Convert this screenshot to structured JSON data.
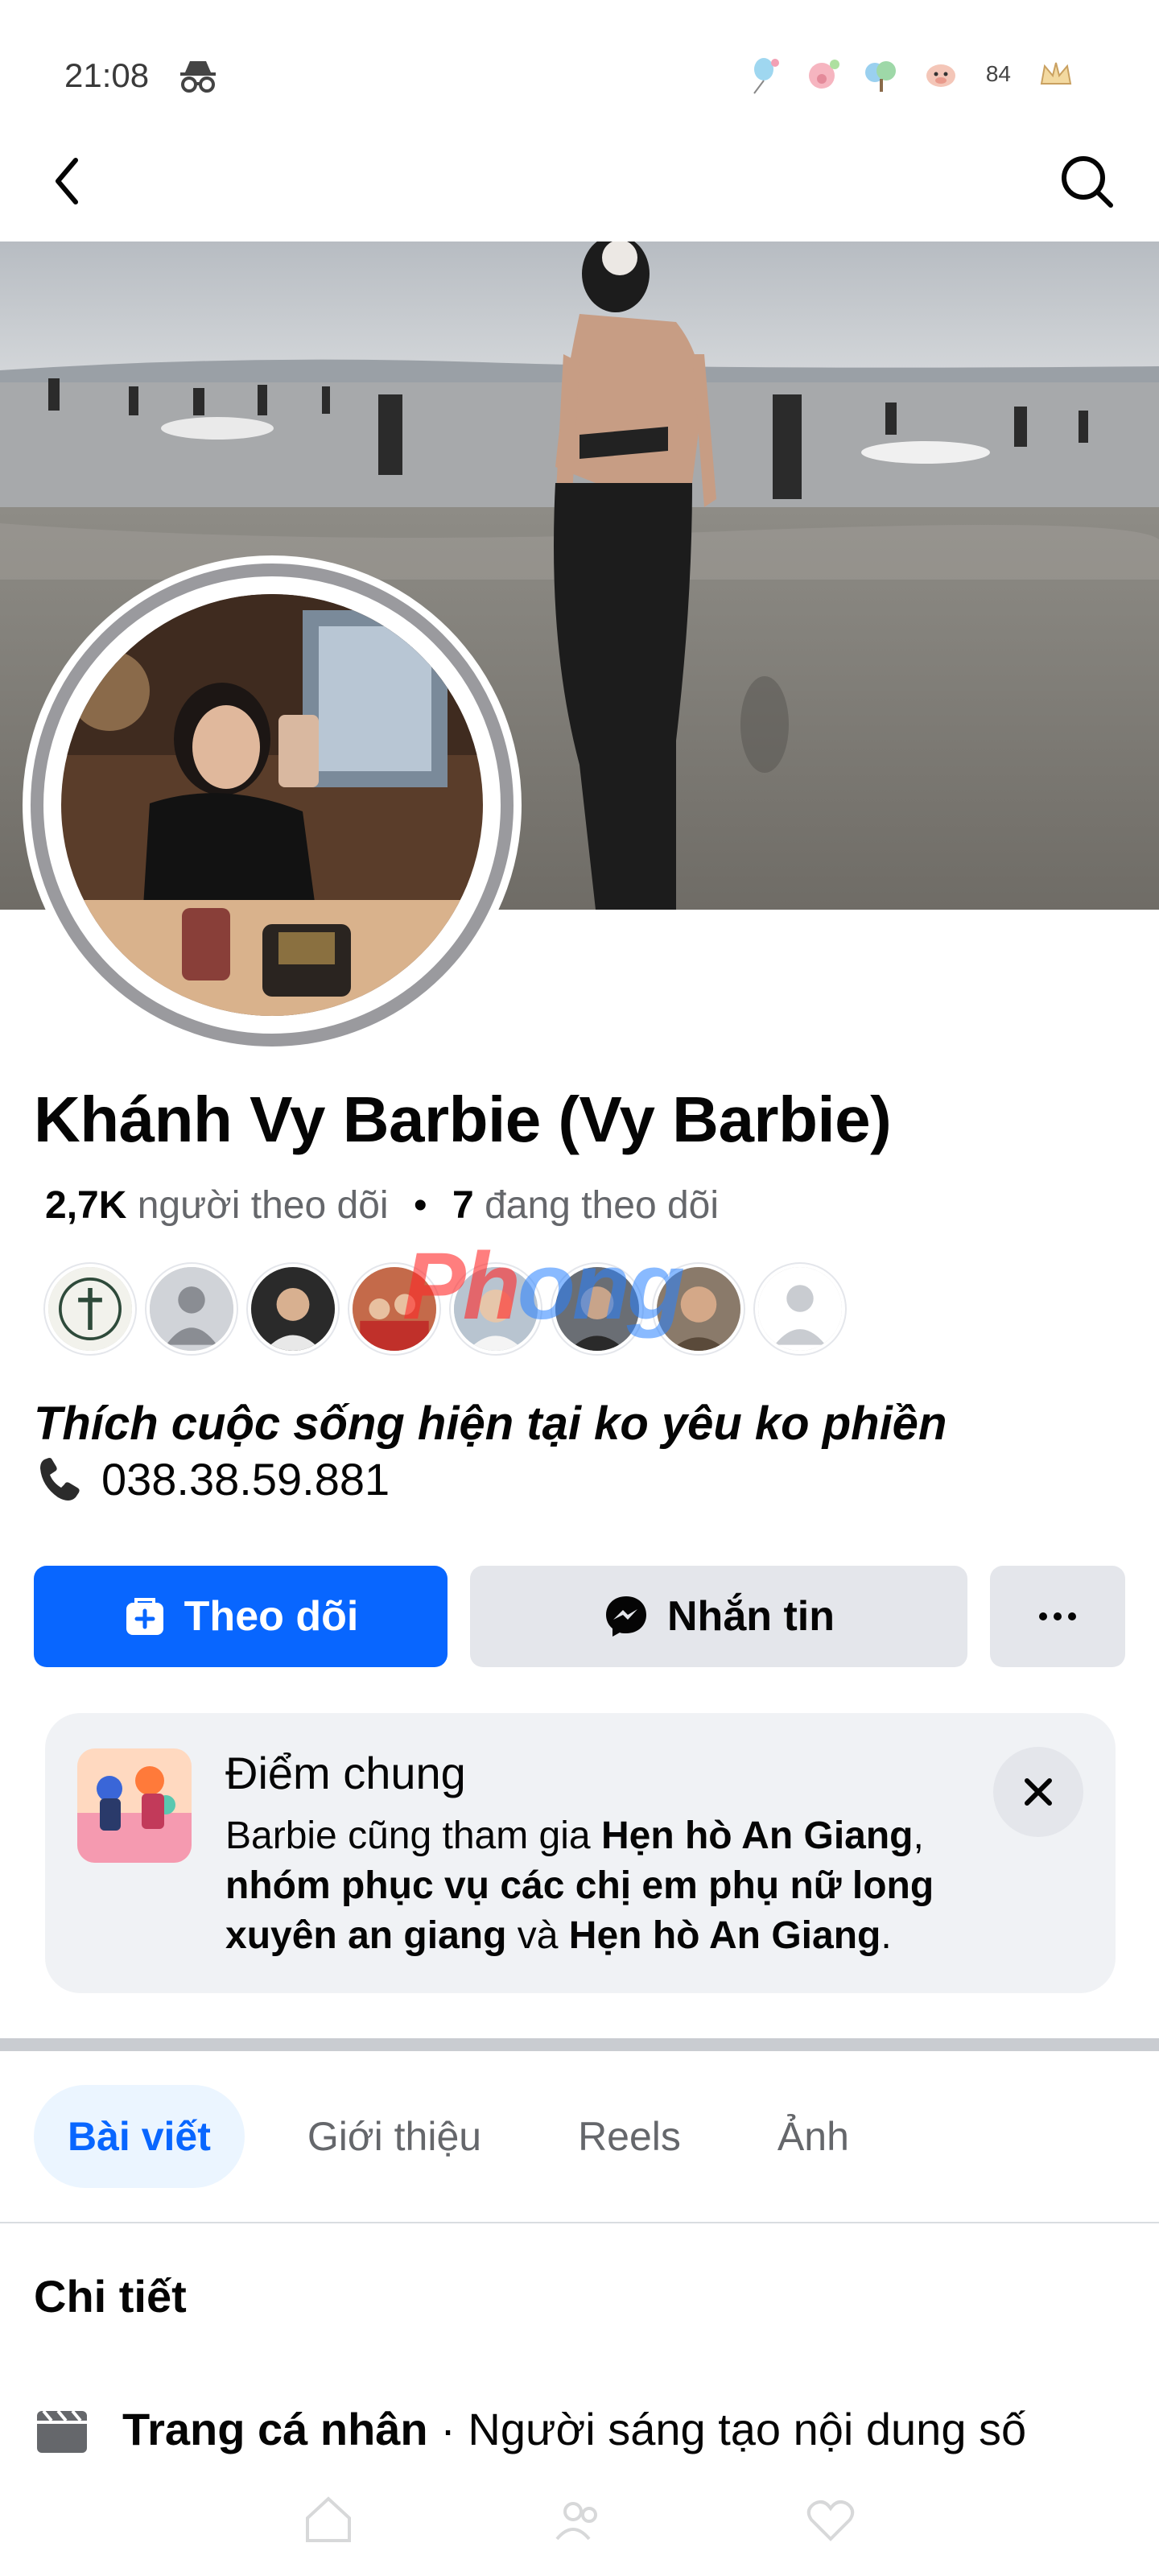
{
  "status_bar": {
    "time": "21:08",
    "notification_count": "84",
    "icons": [
      "incognito-icon",
      "notification-app-icons"
    ]
  },
  "app_bar": {
    "back_icon": "chevron-left-icon",
    "search_icon": "search-icon"
  },
  "profile": {
    "name": "Khánh Vy Barbie (Vy Barbie)",
    "followers_count": "2,7K",
    "followers_label": "người theo dõi",
    "following_count": "7",
    "following_label": "đang theo dõi",
    "bio": "Thích cuộc sống hiện tại ko yêu ko phiền",
    "phone": "038.38.59.881"
  },
  "watermark": {
    "part1": "Ph",
    "part2": "ong"
  },
  "actions": {
    "follow_label": "Theo dõi",
    "message_label": "Nhắn tin",
    "more_label": "···"
  },
  "common_card": {
    "title": "Điểm chung",
    "prefix": "Barbie cũng tham gia",
    "group1": "Hẹn hò An Giang",
    "group2": "nhóm phục vụ các chị em phụ nữ long xuyên an giang",
    "conj": "và",
    "group3": "Hẹn hò An Giang"
  },
  "tabs": [
    {
      "label": "Bài viết",
      "active": true
    },
    {
      "label": "Giới thiệu",
      "active": false
    },
    {
      "label": "Reels",
      "active": false
    },
    {
      "label": "Ảnh",
      "active": false
    }
  ],
  "details": {
    "title": "Chi tiết",
    "row_bold": "Trang cá nhân",
    "row_text": " · Người sáng tạo nội dung số"
  },
  "colors": {
    "accent": "#0866ff",
    "secondary_button": "#e4e6eb",
    "card_bg": "#f0f2f5",
    "muted_text": "#65676b"
  }
}
